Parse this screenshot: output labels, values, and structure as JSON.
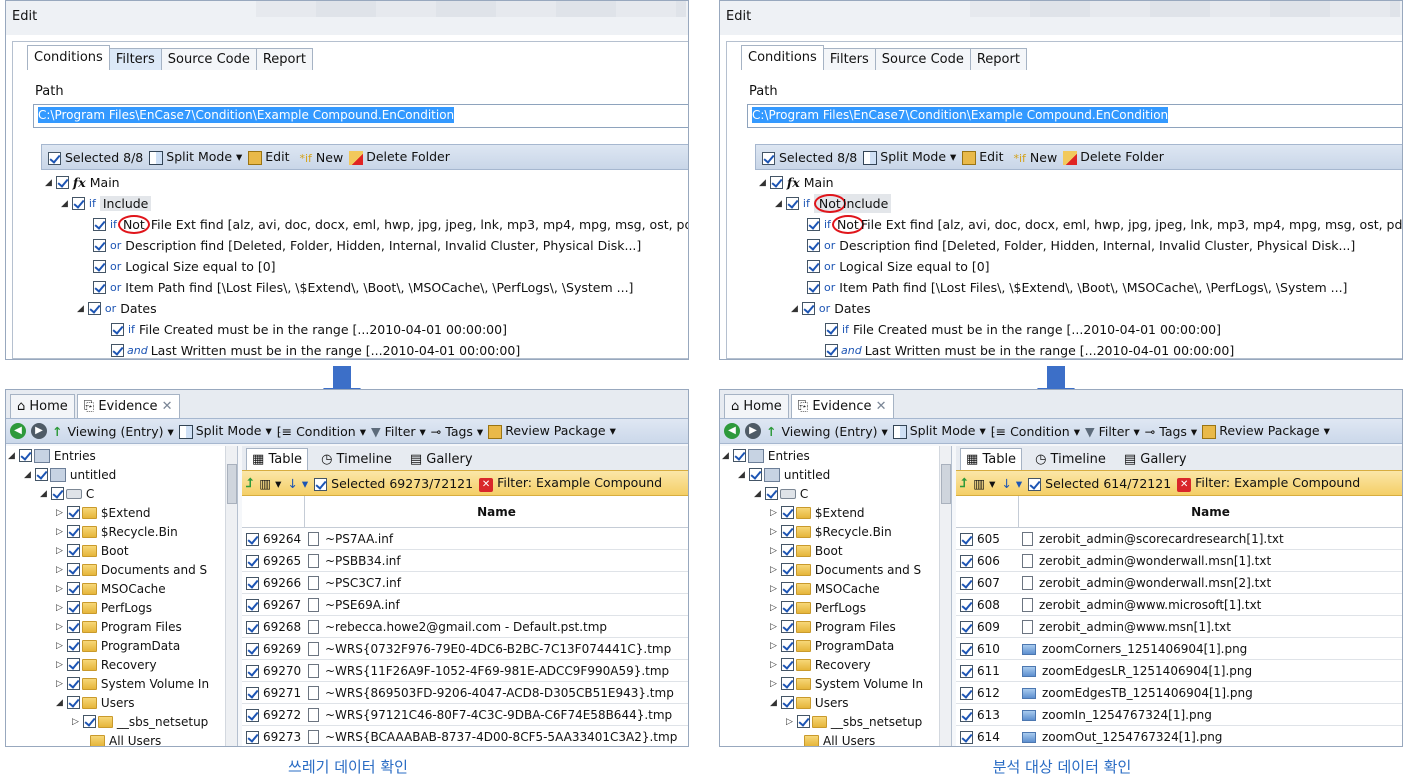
{
  "captions": {
    "left": "쓰레기 데이터 확인",
    "right": "분석 대상 데이터 확인"
  },
  "common": {
    "edit_title": "Edit",
    "tabs": [
      "Conditions",
      "Filters",
      "Source Code",
      "Report"
    ],
    "path_label": "Path",
    "path_value": "C:\\Program Files\\EnCase7\\Condition\\Example Compound.EnCondition",
    "cond_toolbar": {
      "selected": "Selected 8/8",
      "split": "Split Mode",
      "edit": "Edit",
      "new": "New",
      "delete": "Delete Folder"
    },
    "tree": {
      "main": "Main",
      "not": "Not",
      "include": "Include",
      "file_ext": "File Ext find [alz, avi, doc, docx, eml, hwp, jpg, jpeg, lnk, mp3, mp4, mpg, msg, ost, pd...]",
      "description": "Description find [Deleted, Folder, Hidden, Internal, Invalid Cluster, Physical Disk...]",
      "logical_size": "Logical Size equal to [0]",
      "item_path": "Item Path find [\\Lost Files\\, \\$Extend\\, \\Boot\\, \\MSOCache\\, \\PerfLogs\\, \\System ...]",
      "dates": "Dates",
      "created": "File Created must be in the range [...2010-04-01 00:00:00]",
      "written": "Last Written must be in the range [...2010-04-01 00:00:00]",
      "kw_if": "if",
      "kw_or": "or",
      "kw_and": "and"
    },
    "ev_tabs": {
      "home": "Home",
      "evidence": "Evidence"
    },
    "ev_toolbar": {
      "viewing": "Viewing (Entry)",
      "split": "Split Mode",
      "condition": "Condition",
      "filter": "Filter",
      "tags": "Tags",
      "review": "Review Package"
    },
    "left_tree": [
      "Entries",
      "untitled",
      "C",
      "$Extend",
      "$Recycle.Bin",
      "Boot",
      "Documents and S",
      "MSOCache",
      "PerfLogs",
      "Program Files",
      "ProgramData",
      "Recovery",
      "System Volume In",
      "Users",
      "__sbs_netsetup",
      "All Users"
    ],
    "view_tabs": [
      "Table",
      "Timeline",
      "Gallery"
    ],
    "filter_label": "Filter: Example Compound",
    "name_header": "Name"
  },
  "left": {
    "selected": "Selected 69273/72121",
    "rows": [
      {
        "n": "69264",
        "name": "~PS7AA.inf"
      },
      {
        "n": "69265",
        "name": "~PSBB34.inf"
      },
      {
        "n": "69266",
        "name": "~PSC3C7.inf"
      },
      {
        "n": "69267",
        "name": "~PSE69A.inf"
      },
      {
        "n": "69268",
        "name": "~rebecca.howe2@gmail.com - Default.pst.tmp"
      },
      {
        "n": "69269",
        "name": "~WRS{0732F976-79E0-4DC6-B2BC-7C13F074441C}.tmp"
      },
      {
        "n": "69270",
        "name": "~WRS{11F26A9F-1052-4F69-981E-ADCC9F990A59}.tmp"
      },
      {
        "n": "69271",
        "name": "~WRS{869503FD-9206-4047-ACD8-D305CB51E943}.tmp"
      },
      {
        "n": "69272",
        "name": "~WRS{97121C46-80F7-4C3C-9DBA-C6F74E58B644}.tmp"
      },
      {
        "n": "69273",
        "name": "~WRS{BCAAABAB-8737-4D00-8CF5-5AA33401C3A2}.tmp"
      }
    ]
  },
  "right": {
    "selected": "Selected 614/72121",
    "rows": [
      {
        "n": "605",
        "name": "zerobit_admin@scorecardresearch[1].txt"
      },
      {
        "n": "606",
        "name": "zerobit_admin@wonderwall.msn[1].txt"
      },
      {
        "n": "607",
        "name": "zerobit_admin@wonderwall.msn[2].txt"
      },
      {
        "n": "608",
        "name": "zerobit_admin@www.microsoft[1].txt"
      },
      {
        "n": "609",
        "name": "zerobit_admin@www.msn[1].txt"
      },
      {
        "n": "610",
        "name": "zoomCorners_1251406904[1].png"
      },
      {
        "n": "611",
        "name": "zoomEdgesLR_1251406904[1].png"
      },
      {
        "n": "612",
        "name": "zoomEdgesTB_1251406904[1].png"
      },
      {
        "n": "613",
        "name": "zoomIn_1254767324[1].png"
      },
      {
        "n": "614",
        "name": "zoomOut_1254767324[1].png"
      }
    ]
  },
  "colors": {
    "accent": "#2a6cc4",
    "circle": "#e0151b",
    "arrow": "#3c6fc8"
  }
}
